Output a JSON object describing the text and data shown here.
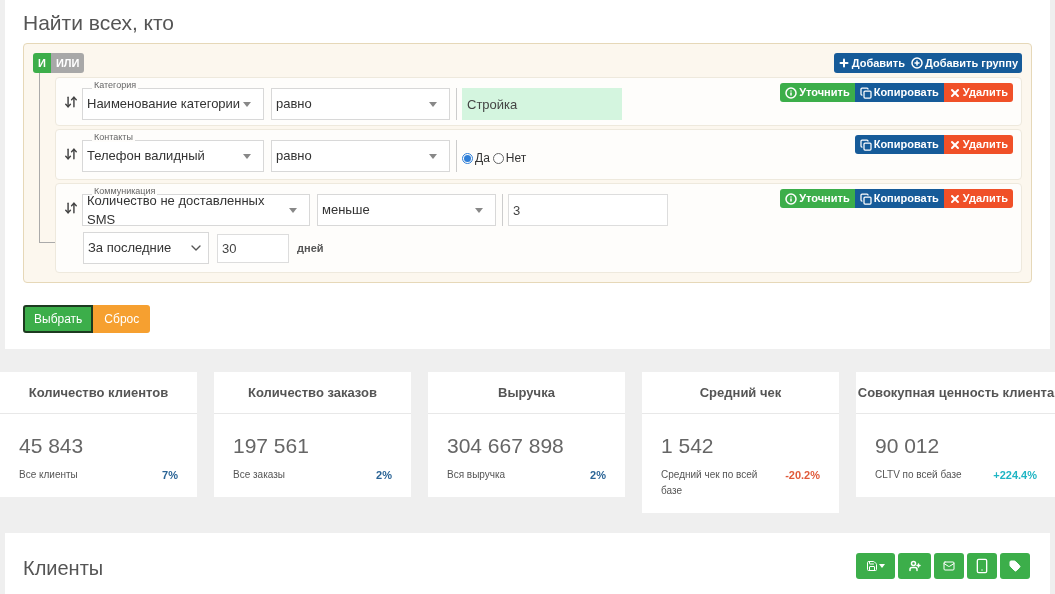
{
  "filter": {
    "title": "Найти всех, кто",
    "logic": [
      {
        "label": "И",
        "selected": true
      },
      {
        "label": "ИЛИ",
        "selected": false
      }
    ],
    "add_buttons": [
      {
        "kind": "add",
        "label": "Добавить"
      },
      {
        "kind": "add_group",
        "label": "Добавить группу"
      }
    ],
    "rules": [
      {
        "group": "Категория",
        "field": "Наименование категории",
        "operator": "равно",
        "value": "Стройка",
        "valid": true,
        "kind": "text",
        "actions": [
          {
            "kind": "refine",
            "label": "Уточнить"
          },
          {
            "kind": "copy",
            "label": "Копировать"
          },
          {
            "kind": "delete",
            "label": "Удалить"
          }
        ]
      },
      {
        "group": "Контакты",
        "field": "Телефон валидный",
        "operator": "равно",
        "kind": "radio",
        "options": [
          {
            "label": "Да",
            "selected": true
          },
          {
            "label": "Нет",
            "selected": false
          }
        ],
        "actions": [
          {
            "kind": "copy",
            "label": "Копировать"
          },
          {
            "kind": "delete",
            "label": "Удалить"
          }
        ]
      },
      {
        "group": "Коммуникация",
        "field": "Количество не доставленных SMS",
        "operator": "меньше",
        "kind": "text",
        "value": "3",
        "valid": false,
        "period": {
          "mode": "За последние",
          "count": "30",
          "unit": "дней"
        },
        "actions": [
          {
            "kind": "refine",
            "label": "Уточнить"
          },
          {
            "kind": "copy",
            "label": "Копировать"
          },
          {
            "kind": "delete",
            "label": "Удалить"
          }
        ]
      }
    ],
    "submit": {
      "label": "Выбрать"
    },
    "reset": {
      "label": "Сброс"
    }
  },
  "stats": [
    {
      "title": "Количество клиентов",
      "value": "45 843",
      "caption": "Все клиенты",
      "change": "7%",
      "color": "#2a6496"
    },
    {
      "title": "Количество заказов",
      "value": "197 561",
      "caption": "Все заказы",
      "change": "2%",
      "color": "#2a6496"
    },
    {
      "title": "Выручка",
      "value": "304 667 898",
      "caption": "Вся выручка",
      "change": "2%",
      "color": "#2a6496"
    },
    {
      "title": "Средний чек",
      "value": "1 542",
      "caption": "Средний чек по всей базе",
      "change": "-20.2%",
      "color": "#e05a3a"
    },
    {
      "title": "Совокупная ценность клиента",
      "value": "90 012",
      "caption": "CLTV по всей базе",
      "change": "+224.4%",
      "color": "#1fb5c4"
    }
  ],
  "clients": {
    "title": "Клиенты"
  }
}
